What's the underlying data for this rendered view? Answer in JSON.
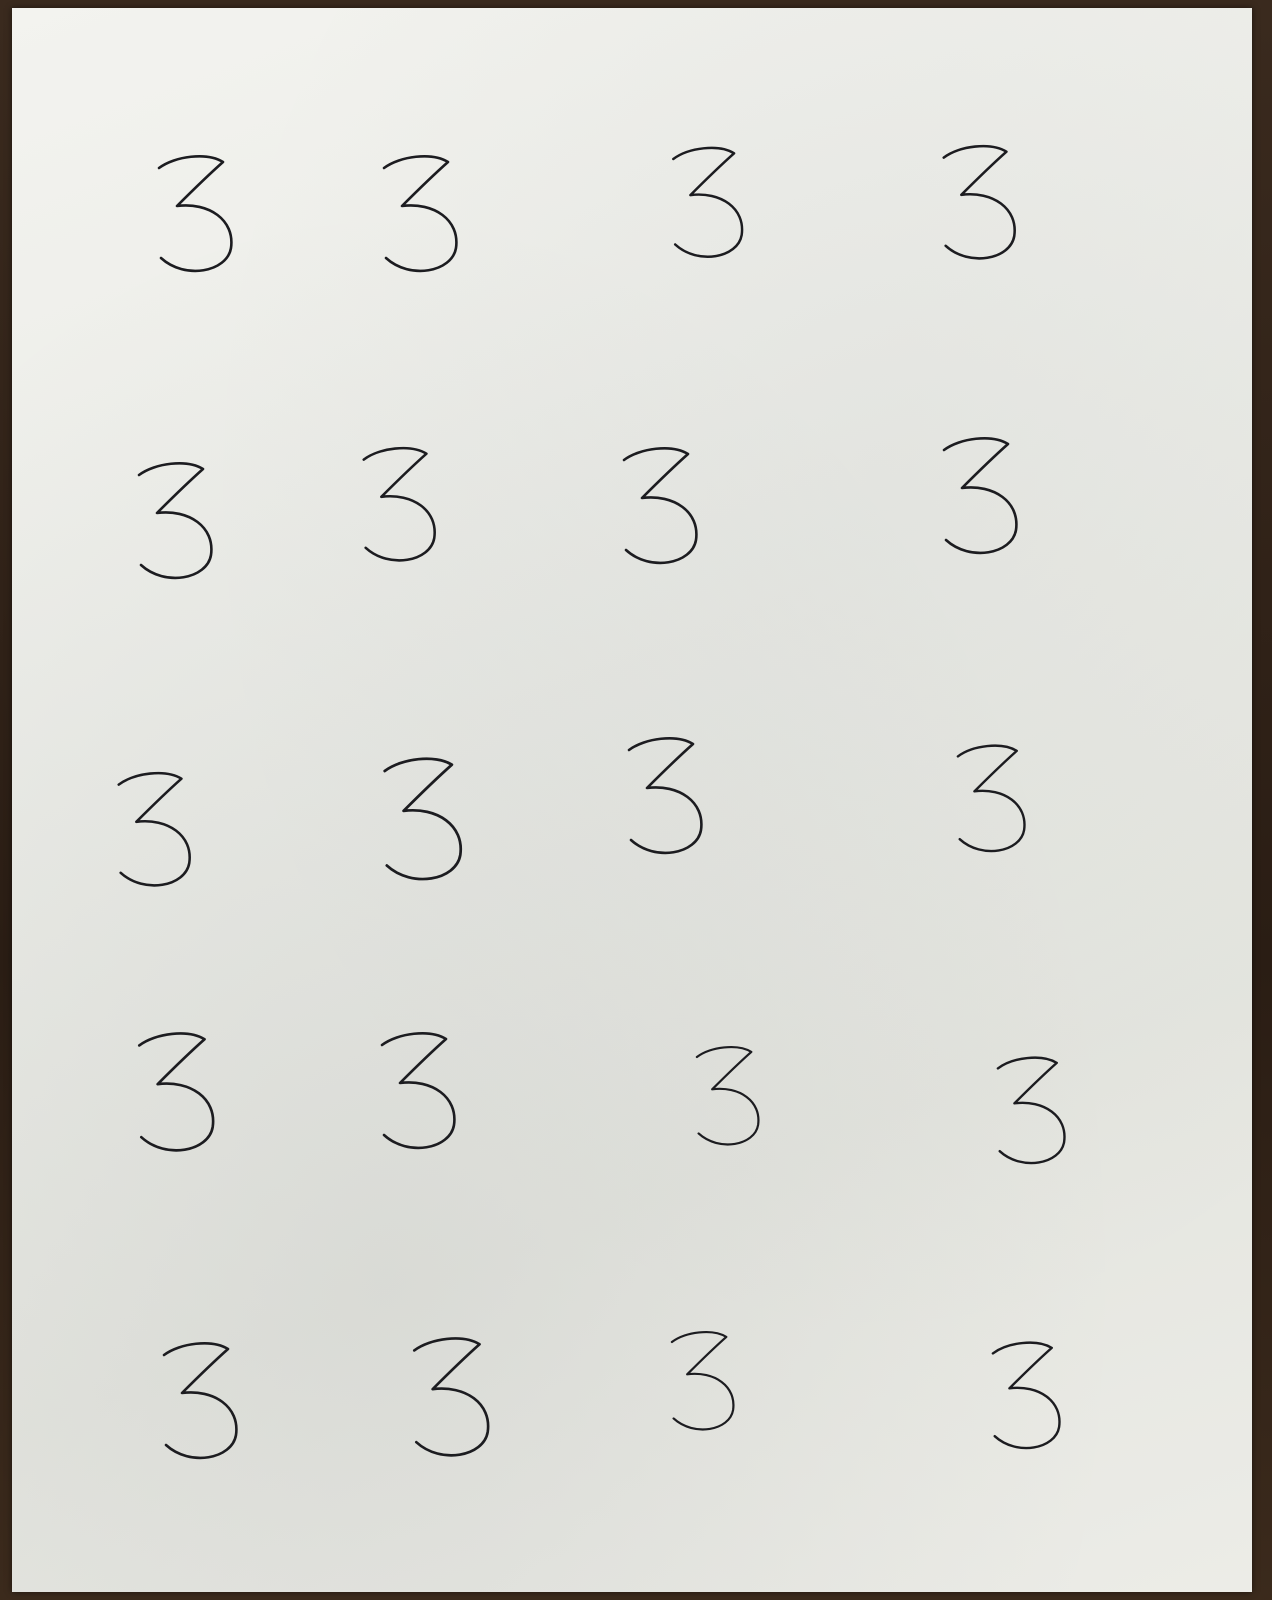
{
  "sheet": {
    "paper_color": "#ecece7",
    "background_color": "#2a1d14",
    "ink_color": "#1c1c20"
  },
  "digits": [
    {
      "row": 1,
      "col": 1,
      "value": "3"
    },
    {
      "row": 1,
      "col": 2,
      "value": "3"
    },
    {
      "row": 1,
      "col": 3,
      "value": "3"
    },
    {
      "row": 1,
      "col": 4,
      "value": "3"
    },
    {
      "row": 2,
      "col": 1,
      "value": "3"
    },
    {
      "row": 2,
      "col": 2,
      "value": "3"
    },
    {
      "row": 2,
      "col": 3,
      "value": "3"
    },
    {
      "row": 2,
      "col": 4,
      "value": "3"
    },
    {
      "row": 3,
      "col": 1,
      "value": "3"
    },
    {
      "row": 3,
      "col": 2,
      "value": "3"
    },
    {
      "row": 3,
      "col": 3,
      "value": "3"
    },
    {
      "row": 3,
      "col": 4,
      "value": "3"
    },
    {
      "row": 4,
      "col": 1,
      "value": "3"
    },
    {
      "row": 4,
      "col": 2,
      "value": "3"
    },
    {
      "row": 4,
      "col": 3,
      "value": "3"
    },
    {
      "row": 4,
      "col": 4,
      "value": "3"
    },
    {
      "row": 5,
      "col": 1,
      "value": "3"
    },
    {
      "row": 5,
      "col": 2,
      "value": "3"
    },
    {
      "row": 5,
      "col": 3,
      "value": "3"
    },
    {
      "row": 5,
      "col": 4,
      "value": "3"
    }
  ]
}
